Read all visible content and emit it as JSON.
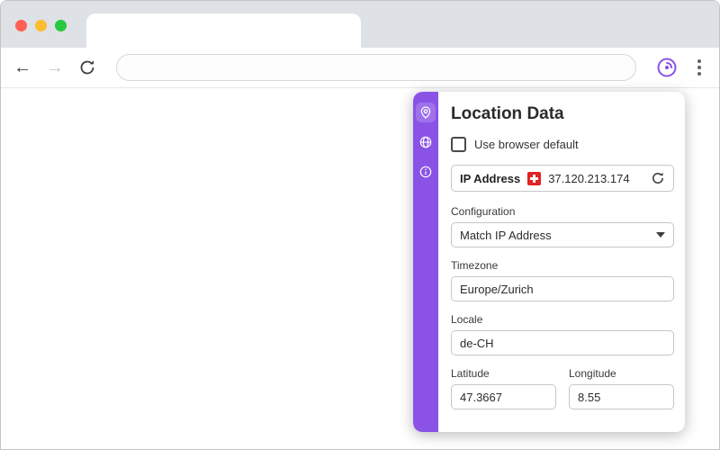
{
  "colors": {
    "accent": "#8a53e6",
    "flag_red": "#e02424"
  },
  "browser": {
    "tab_title": "",
    "url_value": "",
    "back_icon": "←",
    "forward_icon": "→",
    "icons": [
      "close-window",
      "minimize-window",
      "zoom-window",
      "back",
      "forward",
      "reload",
      "vytal-extension",
      "menu-dots"
    ]
  },
  "panel": {
    "title": "Location Data",
    "checkbox_label": "Use browser default",
    "checkbox_checked": false,
    "rail_icons": [
      "location-pin-icon",
      "globe-icon",
      "info-icon"
    ],
    "ip": {
      "label": "IP Address",
      "value": "37.120.213.174",
      "flag": "swiss-flag-icon",
      "refresh": "refresh-icon"
    },
    "configuration": {
      "label": "Configuration",
      "value": "Match IP Address"
    },
    "timezone": {
      "label": "Timezone",
      "value": "Europe/Zurich"
    },
    "locale": {
      "label": "Locale",
      "value": "de-CH"
    },
    "latitude": {
      "label": "Latitude",
      "value": "47.3667"
    },
    "longitude": {
      "label": "Longitude",
      "value": "8.55"
    }
  }
}
